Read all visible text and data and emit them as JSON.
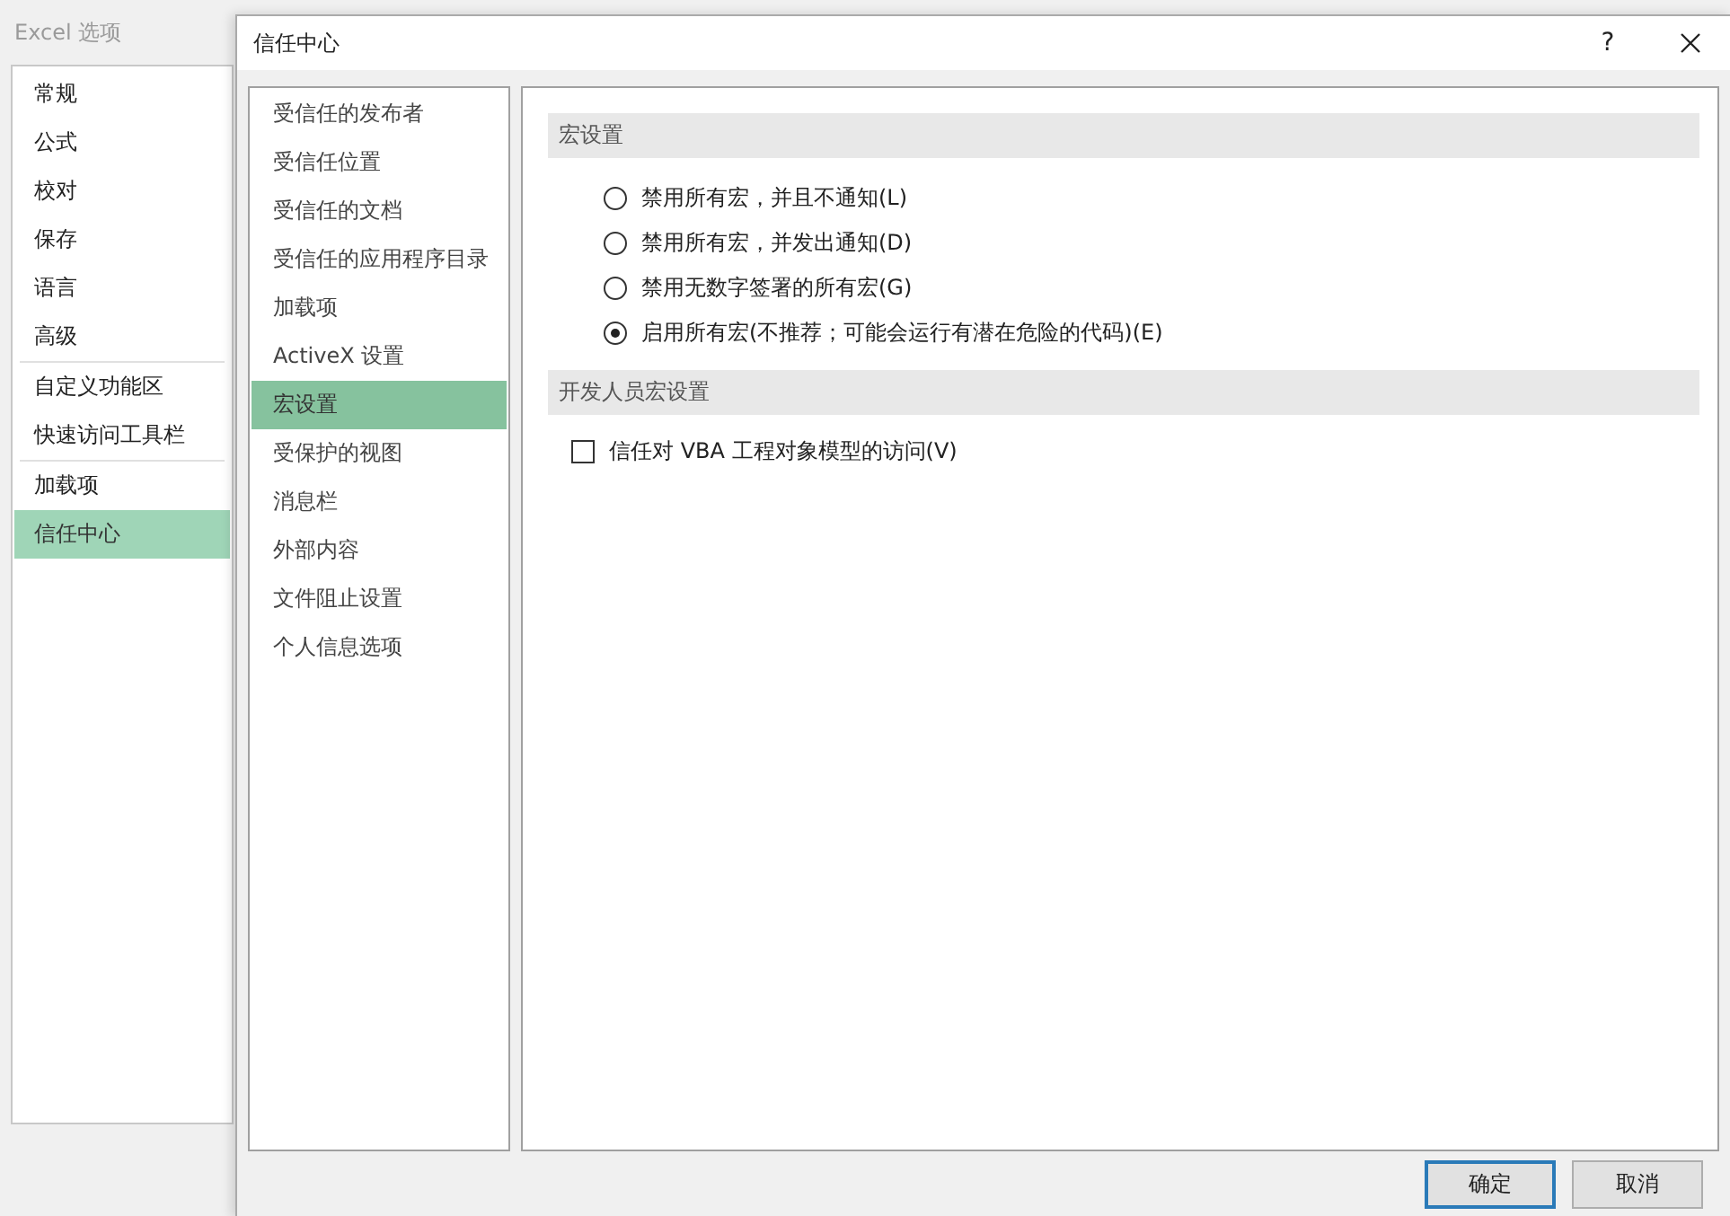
{
  "options_window": {
    "title": "Excel 选项",
    "categories": [
      {
        "label": "常规",
        "selected": false,
        "divider_above": false
      },
      {
        "label": "公式",
        "selected": false,
        "divider_above": false
      },
      {
        "label": "校对",
        "selected": false,
        "divider_above": false
      },
      {
        "label": "保存",
        "selected": false,
        "divider_above": false
      },
      {
        "label": "语言",
        "selected": false,
        "divider_above": false
      },
      {
        "label": "高级",
        "selected": false,
        "divider_above": false
      },
      {
        "label": "自定义功能区",
        "selected": false,
        "divider_above": true
      },
      {
        "label": "快速访问工具栏",
        "selected": false,
        "divider_above": false
      },
      {
        "label": "加载项",
        "selected": false,
        "divider_above": true
      },
      {
        "label": "信任中心",
        "selected": true,
        "divider_above": false
      }
    ]
  },
  "dialog": {
    "title": "信任中心",
    "help": "?",
    "nav": [
      {
        "label": "受信任的发布者",
        "selected": false
      },
      {
        "label": "受信任位置",
        "selected": false
      },
      {
        "label": "受信任的文档",
        "selected": false
      },
      {
        "label": "受信任的应用程序目录",
        "selected": false
      },
      {
        "label": "加载项",
        "selected": false
      },
      {
        "label": "ActiveX 设置",
        "selected": false
      },
      {
        "label": "宏设置",
        "selected": true
      },
      {
        "label": "受保护的视图",
        "selected": false
      },
      {
        "label": "消息栏",
        "selected": false
      },
      {
        "label": "外部内容",
        "selected": false
      },
      {
        "label": "文件阻止设置",
        "selected": false
      },
      {
        "label": "个人信息选项",
        "selected": false
      }
    ],
    "sections": [
      {
        "heading": "宏设置",
        "options": [
          {
            "kind": "radio",
            "label": "禁用所有宏，并且不通知(L)",
            "selected": false
          },
          {
            "kind": "radio",
            "label": "禁用所有宏，并发出通知(D)",
            "selected": false
          },
          {
            "kind": "radio",
            "label": "禁用无数字签署的所有宏(G)",
            "selected": false
          },
          {
            "kind": "radio",
            "label": "启用所有宏(不推荐；可能会运行有潜在危险的代码)(E)",
            "selected": true
          }
        ]
      },
      {
        "heading": "开发人员宏设置",
        "options": [
          {
            "kind": "checkbox",
            "label": "信任对 VBA 工程对象模型的访问(V)",
            "checked": false
          }
        ]
      }
    ],
    "buttons": [
      {
        "label": "确定",
        "default": true
      },
      {
        "label": "取消",
        "default": false
      }
    ]
  }
}
